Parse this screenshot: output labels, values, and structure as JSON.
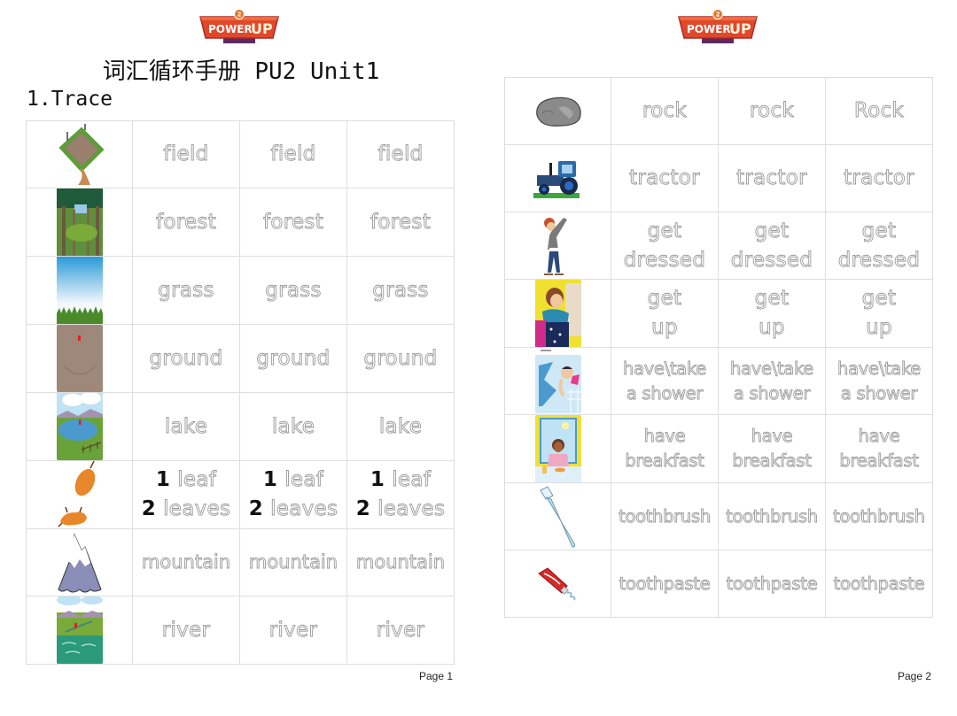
{
  "document": {
    "brand": {
      "logo_text_1": "POWER",
      "logo_text_2": "UP",
      "logo_badge": "2",
      "colors": {
        "banner": "#e0482a",
        "banner_dark": "#5b2a63",
        "text": "#ffffff",
        "up_text": "#ffe6b0"
      }
    },
    "title": "词汇循环手册 PU2 Unit1",
    "section": "1.Trace"
  },
  "pages": [
    {
      "page_label": "Page 1",
      "rows": [
        {
          "image": "field-icon",
          "lines": [
            [
              "field"
            ]
          ],
          "words": [
            "field",
            "field",
            "field"
          ]
        },
        {
          "image": "forest-icon",
          "words": [
            "forest",
            "forest",
            "forest"
          ]
        },
        {
          "image": "grass-icon",
          "words": [
            "grass",
            "grass",
            "grass"
          ]
        },
        {
          "image": "ground-icon",
          "words": [
            "ground",
            "ground",
            "ground"
          ]
        },
        {
          "image": "lake-icon",
          "words": [
            "lake",
            "lake",
            "lake"
          ]
        },
        {
          "image": "leaf-icon",
          "line1_num": "1",
          "line1": "leaf",
          "line2_num": "2",
          "line2": "leaves"
        },
        {
          "image": "mountain-icon",
          "words": [
            "mountain",
            "mountain",
            "mountain"
          ]
        },
        {
          "image": "river-icon",
          "words": [
            "river",
            "river",
            "river"
          ]
        }
      ]
    },
    {
      "page_label": "Page 2",
      "rows": [
        {
          "image": "rock-icon",
          "words": [
            "rock",
            "rock",
            "Rock"
          ]
        },
        {
          "image": "tractor-icon",
          "words": [
            "tractor",
            "tractor",
            "tractor"
          ]
        },
        {
          "image": "get-dressed-icon",
          "line1": "get",
          "line2": "dressed"
        },
        {
          "image": "get-up-icon",
          "line1": "get",
          "line2": "up"
        },
        {
          "image": "shower-icon",
          "line1": "have\\take",
          "line2": "a shower"
        },
        {
          "image": "breakfast-icon",
          "line1": "have",
          "line2": "breakfast"
        },
        {
          "image": "toothbrush-icon",
          "words": [
            "toothbrush",
            "toothbrush",
            "toothbrush"
          ]
        },
        {
          "image": "toothpaste-icon",
          "words": [
            "toothpaste",
            "toothpaste",
            "toothpaste"
          ]
        }
      ]
    }
  ]
}
